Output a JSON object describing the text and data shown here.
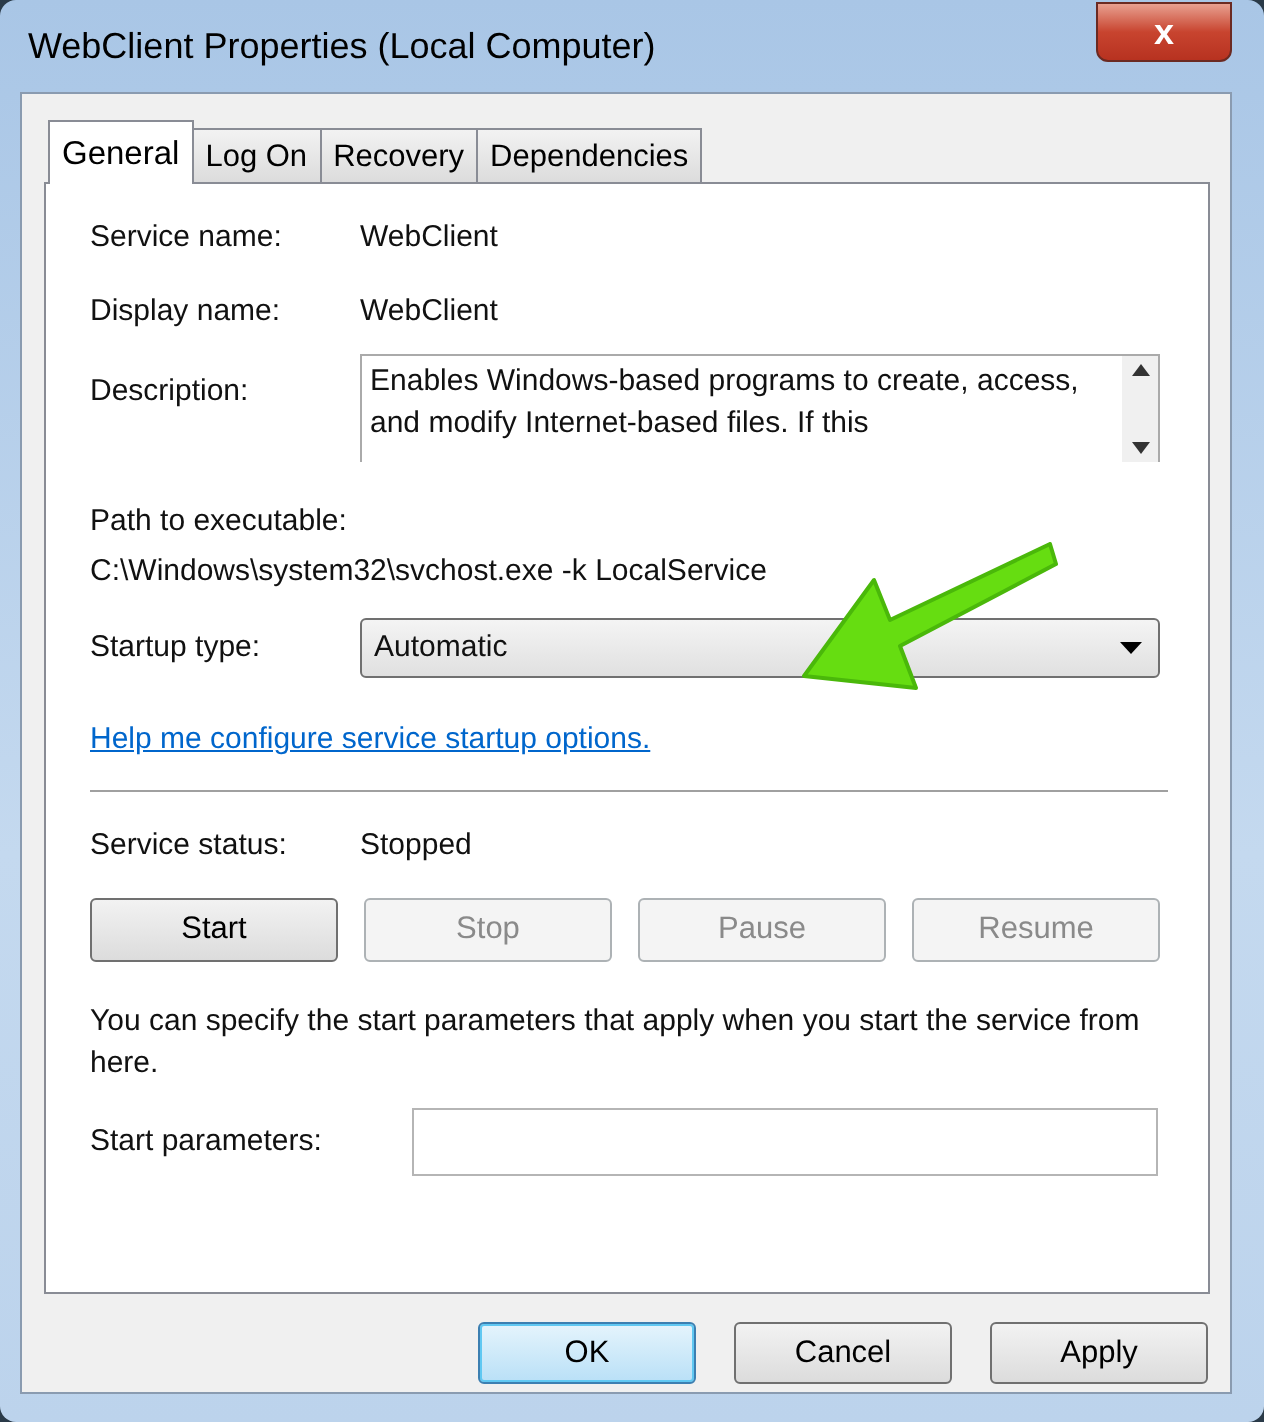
{
  "window": {
    "title": "WebClient Properties (Local Computer)",
    "close_icon": "x"
  },
  "tabs": [
    {
      "label": "General",
      "selected": true
    },
    {
      "label": "Log On",
      "selected": false
    },
    {
      "label": "Recovery",
      "selected": false
    },
    {
      "label": "Dependencies",
      "selected": false
    }
  ],
  "fields": [
    {
      "label": "Service name:",
      "value": "WebClient"
    },
    {
      "label": "Display name:",
      "value": "WebClient"
    }
  ],
  "description": {
    "label": "Description:",
    "text": "Enables Windows-based programs to create, access, and modify Internet-based files. If this"
  },
  "path": {
    "label": "Path to executable:",
    "value": "C:\\Windows\\system32\\svchost.exe -k LocalService"
  },
  "startup": {
    "label": "Startup type:",
    "value": "Automatic"
  },
  "help_link": "Help me configure service startup options.",
  "status": {
    "label": "Service status:",
    "value": "Stopped"
  },
  "service_buttons": [
    {
      "label": "Start",
      "disabled": false
    },
    {
      "label": "Stop",
      "disabled": true
    },
    {
      "label": "Pause",
      "disabled": true
    },
    {
      "label": "Resume",
      "disabled": true
    }
  ],
  "note": "You can specify the start parameters that apply when you start the service from here.",
  "start_parameters": {
    "label": "Start parameters:"
  },
  "dialog_buttons": [
    {
      "label": "OK",
      "default": true
    },
    {
      "label": "Cancel",
      "default": false
    },
    {
      "label": "Apply",
      "default": false
    }
  ]
}
